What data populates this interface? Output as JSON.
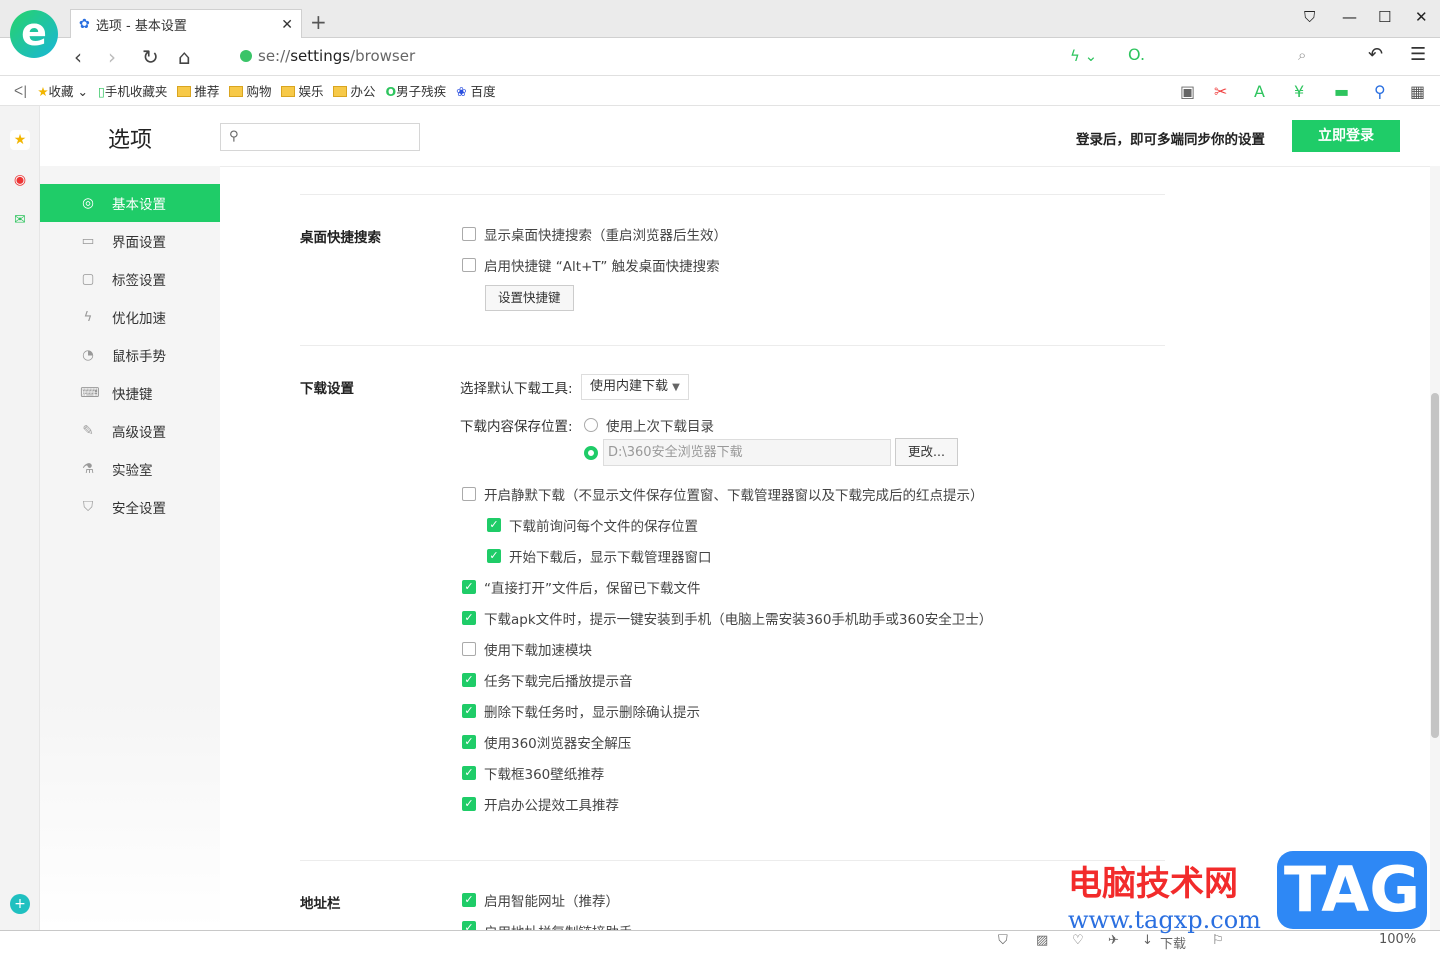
{
  "browser": {
    "tab_title": "选项 - 基本设置",
    "url_prefix": "se://",
    "url_host": "settings",
    "url_path": "/browser",
    "logo": "e",
    "bookmarks": [
      {
        "label": "收藏",
        "icon": "star-icon"
      },
      {
        "label": "手机收藏夹",
        "icon": "phone-icon"
      },
      {
        "label": "推荐",
        "icon": "folder-icon"
      },
      {
        "label": "购物",
        "icon": "folder-icon"
      },
      {
        "label": "娱乐",
        "icon": "folder-icon"
      },
      {
        "label": "办公",
        "icon": "folder-icon"
      },
      {
        "label": "男子残疾",
        "icon": "360-icon"
      },
      {
        "label": "百度",
        "icon": "baidu-icon"
      }
    ]
  },
  "header": {
    "title": "选项",
    "search_placeholder": "",
    "login_text": "登录后，即可多端同步你的设置",
    "login_button": "立即登录"
  },
  "sidebar": [
    {
      "label": "基本设置",
      "icon": "◎"
    },
    {
      "label": "界面设置",
      "icon": "▭"
    },
    {
      "label": "标签设置",
      "icon": "▢"
    },
    {
      "label": "优化加速",
      "icon": "ϟ"
    },
    {
      "label": "鼠标手势",
      "icon": "◔"
    },
    {
      "label": "快捷键",
      "icon": "⌨"
    },
    {
      "label": "高级设置",
      "icon": "✎"
    },
    {
      "label": "实验室",
      "icon": "⚗"
    },
    {
      "label": "安全设置",
      "icon": "⛉"
    }
  ],
  "desktop_search": {
    "title": "桌面快捷搜索",
    "opt1": "显示桌面快捷搜索（重启浏览器后生效）",
    "opt2": "启用快捷键 “Alt+T” 触发桌面快捷搜索",
    "button": "设置快捷键"
  },
  "download": {
    "title": "下载设置",
    "tool_label": "选择默认下载工具:",
    "tool_value": "使用内建下载",
    "save_label": "下载内容保存位置:",
    "radio1": "使用上次下载目录",
    "path": "D:\\360安全浏览器下载",
    "change": "更改...",
    "options": [
      {
        "label": "开启静默下载（不显示文件保存位置窗、下载管理器窗以及下载完成后的红点提示）",
        "checked": false,
        "indent": false
      },
      {
        "label": "下载前询问每个文件的保存位置",
        "checked": true,
        "indent": true
      },
      {
        "label": "开始下载后，显示下载管理器窗口",
        "checked": true,
        "indent": true
      },
      {
        "label": "“直接打开”文件后，保留已下载文件",
        "checked": true,
        "indent": false
      },
      {
        "label": "下载apk文件时，提示一键安装到手机（电脑上需安装360手机助手或360安全卫士）",
        "checked": true,
        "indent": false
      },
      {
        "label": "使用下载加速模块",
        "checked": false,
        "indent": false
      },
      {
        "label": "任务下载完后播放提示音",
        "checked": true,
        "indent": false
      },
      {
        "label": "删除下载任务时，显示删除确认提示",
        "checked": true,
        "indent": false
      },
      {
        "label": "使用360浏览器安全解压",
        "checked": true,
        "indent": false
      },
      {
        "label": "下载框360壁纸推荐",
        "checked": true,
        "indent": false
      },
      {
        "label": "开启办公提效工具推荐",
        "checked": true,
        "indent": false
      }
    ]
  },
  "addressbar": {
    "title": "地址栏",
    "opt1": "启用智能网址（推荐）",
    "opt2": "启用地址栏复制链接助手"
  },
  "status": {
    "download": "下载",
    "zoom": "100%"
  },
  "watermark": {
    "cn": "电脑技术网",
    "url": "www.tagxp.com",
    "badge": "TAG"
  }
}
